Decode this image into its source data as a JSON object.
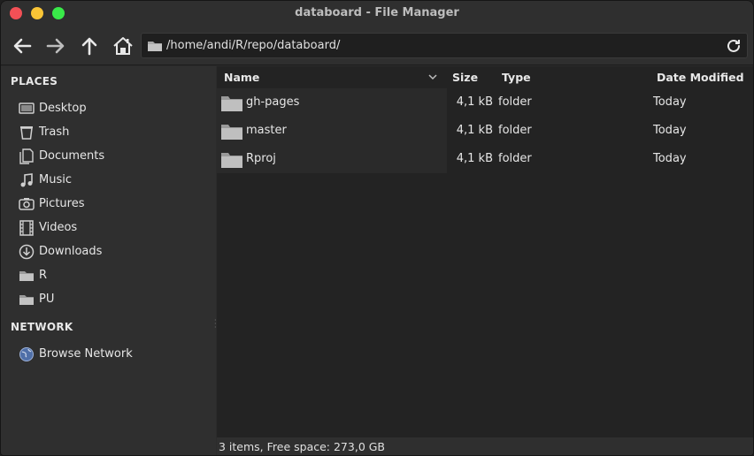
{
  "window": {
    "title": "databoard - File Manager"
  },
  "toolbar": {
    "back_icon": "arrow-left-icon",
    "forward_icon": "arrow-right-icon",
    "up_icon": "arrow-up-icon",
    "home_icon": "home-icon"
  },
  "location": {
    "path": "/home/andi/R/repo/databoard/"
  },
  "sidebar": {
    "places_title": "PLACES",
    "network_title": "NETWORK",
    "places": [
      {
        "label": "Desktop",
        "icon": "desktop-icon"
      },
      {
        "label": "Trash",
        "icon": "trash-icon"
      },
      {
        "label": "Documents",
        "icon": "documents-icon"
      },
      {
        "label": "Music",
        "icon": "music-icon"
      },
      {
        "label": "Pictures",
        "icon": "camera-icon"
      },
      {
        "label": "Videos",
        "icon": "film-icon"
      },
      {
        "label": "Downloads",
        "icon": "download-icon"
      },
      {
        "label": "R",
        "icon": "folder-icon"
      },
      {
        "label": "PU",
        "icon": "folder-icon"
      }
    ],
    "network": [
      {
        "label": "Browse Network",
        "icon": "globe-icon"
      }
    ]
  },
  "columns": {
    "name": "Name",
    "size": "Size",
    "type": "Type",
    "date": "Date Modified"
  },
  "files": [
    {
      "name": "gh-pages",
      "size": "4,1 kB",
      "type": "folder",
      "date": "Today"
    },
    {
      "name": "master",
      "size": "4,1 kB",
      "type": "folder",
      "date": "Today"
    },
    {
      "name": "Rproj",
      "size": "4,1 kB",
      "type": "folder",
      "date": "Today"
    }
  ],
  "status": {
    "text": "3 items, Free space: 273,0 GB"
  },
  "colors": {
    "close": "#f25056",
    "minimize": "#fac536",
    "maximize": "#39ea49"
  }
}
